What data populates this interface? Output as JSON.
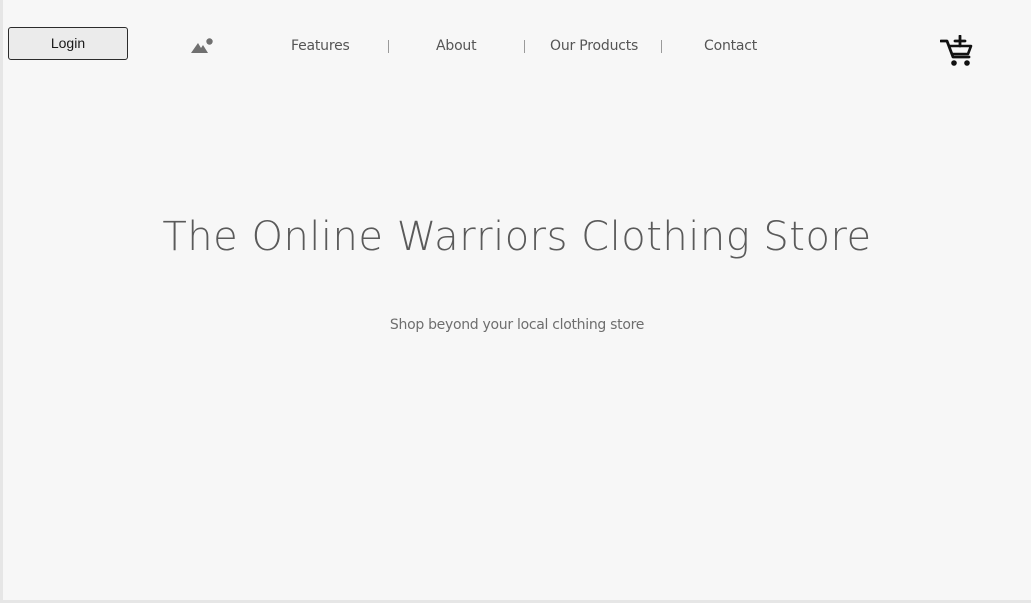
{
  "header": {
    "login_label": "Login",
    "logo_icon": "image-icon",
    "cart_icon": "add-to-cart-icon",
    "nav": [
      {
        "label": "Features"
      },
      {
        "label": "About"
      },
      {
        "label": "Our Products"
      },
      {
        "label": "Contact"
      }
    ]
  },
  "hero": {
    "title": "The Online Warriors Clothing Store",
    "subtitle": "Shop beyond your local clothing store"
  },
  "colors": {
    "background": "#f7f7f7",
    "text": "#555555",
    "cart": "#111111"
  }
}
